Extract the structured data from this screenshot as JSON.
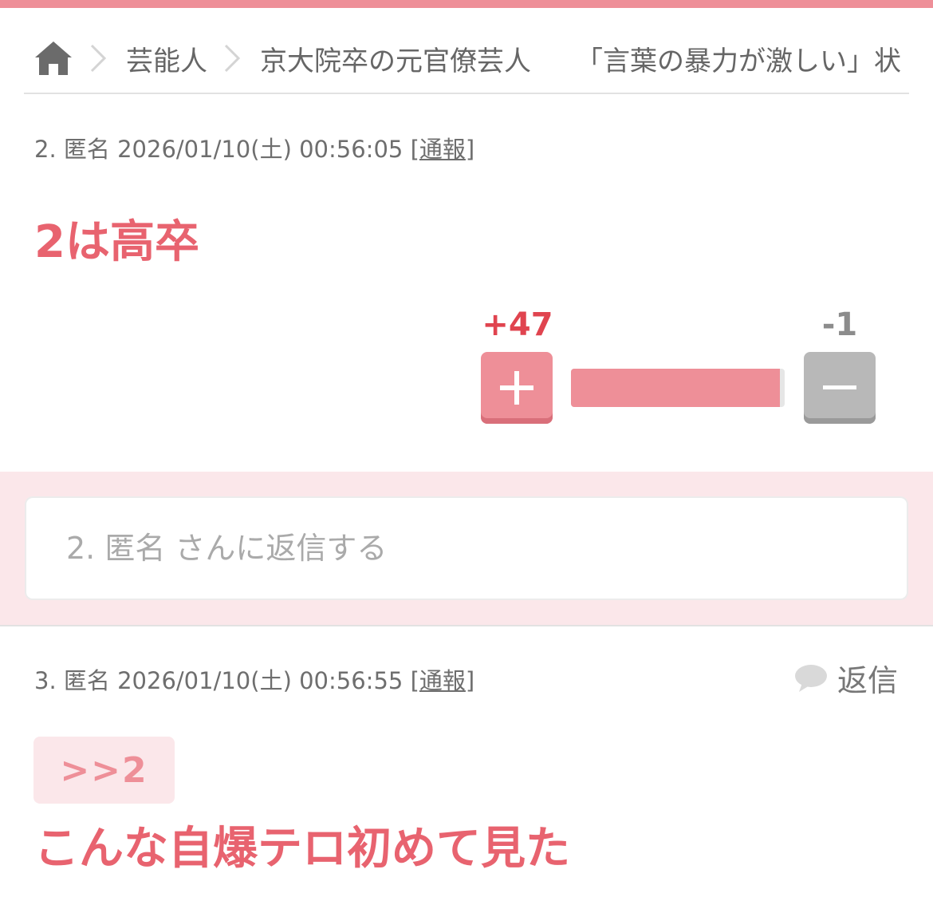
{
  "breadcrumb": {
    "home_icon": "home-icon",
    "items": [
      "芸能人",
      "京大院卒の元官僚芸人",
      "「言葉の暴力が激しい」状"
    ]
  },
  "comments": [
    {
      "number_name": "2. 匿名",
      "timestamp": "2026/01/10(土) 00:56:05",
      "report_label": "通報",
      "body": "2は高卒",
      "votes": {
        "plus": "+47",
        "minus": "-1",
        "plus_ratio": 0.979
      }
    },
    {
      "number_name": "3. 匿名",
      "timestamp": "2026/01/10(土) 00:56:55",
      "report_label": "通報",
      "reply_label": "返信",
      "anchor": ">>2",
      "body": "こんな自爆テロ初めて見た"
    }
  ],
  "reply_box": {
    "placeholder": "2. 匿名 さんに返信する"
  },
  "colors": {
    "accent": "#ee8f98",
    "body_text": "#e8636f",
    "plus_count": "#e0444f",
    "minus": "#b8b8b8"
  }
}
